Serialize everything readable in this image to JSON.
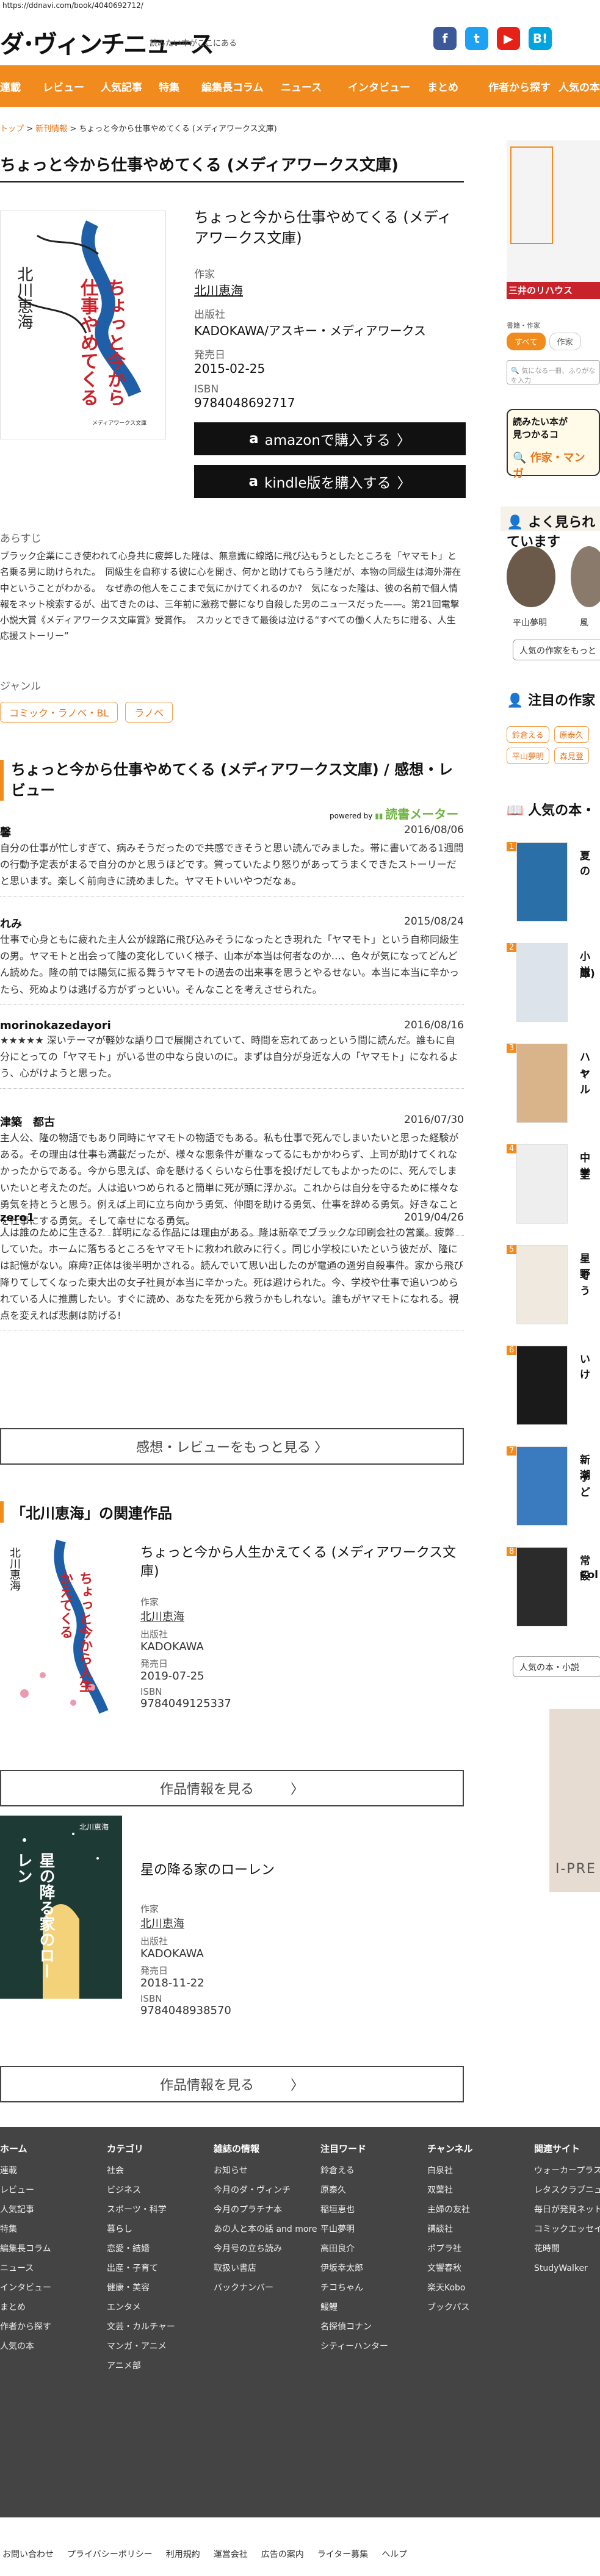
{
  "url": "https://ddnavi.com/book/4040692712/",
  "site": {
    "logo": "ダ･ヴィンチニュース",
    "tagline": "読みたい本がここにある"
  },
  "social": [
    {
      "name": "facebook",
      "glyph": "f",
      "color": "#3b5998"
    },
    {
      "name": "twitter",
      "glyph": "t",
      "color": "#1da1f2"
    },
    {
      "name": "youtube",
      "glyph": "▶",
      "color": "#e62117"
    },
    {
      "name": "hatena",
      "glyph": "B!",
      "color": "#00a4de"
    }
  ],
  "nav": [
    "連載",
    "レビュー",
    "人気記事",
    "特集",
    "編集長コラム",
    "ニュース",
    "インタビュー",
    "まとめ",
    "作者から探す",
    "人気の本"
  ],
  "breadcrumb": {
    "home": "トップ",
    "sep1": ">",
    "section": "新刊情報",
    "sep2": ">",
    "current": "ちょっと今から仕事やめてくる (メディアワークス文庫)"
  },
  "page_title": "ちょっと今から仕事やめてくる (メディアワークス文庫)",
  "book": {
    "title": "ちょっと今から仕事やめてくる (メディアワークス文庫)",
    "cover_author": "北川恵海",
    "cover_title": "ちょっと今から仕事やめてくる",
    "cover_footer": "メディアワークス文庫",
    "author_label": "作家",
    "author": "北川恵海",
    "publisher_label": "出版社",
    "publisher": "KADOKAWA/アスキー・メディアワークス",
    "date_label": "発売日",
    "date": "2015-02-25",
    "isbn_label": "ISBN",
    "isbn": "9784048692717",
    "amazon_btn": "amazonで購入する",
    "kindle_btn": "kindle版を購入する",
    "synopsis_label": "あらすじ",
    "synopsis": "ブラック企業にこき使われて心身共に疲弊した隆は、無意識に線路に飛び込もうとしたところを「ヤマモト」と名乗る男に助けられた。　同級生を自称する彼に心を開き、何かと助けてもらう隆だが、本物の同級生は海外滞在中ということがわかる。　なぜ赤の他人をここまで気にかけてくれるのか?　気になった隆は、彼の名前で個人情報をネット検索するが、出てきたのは、三年前に激務で鬱になり自殺した男のニュースだった——。第21回電撃小説大賞《メディアワークス文庫賞》受賞作。　スカッとできて最後は泣ける“すべての働く人たちに贈る、人生応援ストーリー”",
    "genre_label": "ジャンル",
    "genres": [
      "コミック・ラノベ・BL",
      "ラノベ"
    ]
  },
  "reviews_section": {
    "title": "ちょっと今から仕事やめてくる (メディアワークス文庫) / 感想・レビュー",
    "powered": "powered by",
    "meter": "読書メーター"
  },
  "reviews": [
    {
      "name": "馨",
      "date": "2016/08/06",
      "text": "自分の仕事が忙しすぎて、病みそうだったので共感できそうと思い読んでみました。帯に書いてある1週間の行動予定表がまるで自分のかと思うほどです。質っていたより怒りがあってうまくできたストーリーだと思います。楽しく前向きに読めました。ヤマモトいいやつだなぁ。"
    },
    {
      "name": "れみ",
      "date": "2015/08/24",
      "text": "仕事で心身ともに疲れた主人公が線路に飛び込みそうになったとき現れた「ヤマモト」という自称同級生の男。ヤマモトと出会って隆の変化していく様子、山本が本当は何者なのか…、色々が気になってどんどん読めた。隆の前では陽気に振る舞うヤマモトの過去の出来事を思うとやるせない。本当に本当に辛かったら、死ぬよりは逃げる方がずっといい。そんなことを考えさせられた。"
    },
    {
      "name": "morinokazedayori",
      "date": "2016/08/16",
      "text": "★★★★★ 深いテーマが軽妙な語り口で展開されていて、時間を忘れてあっという間に読んだ。誰もに自分にとっての「ヤマモト」がいる世の中なら良いのに。まずは自分が身近な人の「ヤマモト」になれるよう、心がけようと思った。"
    },
    {
      "name": "津築　都古",
      "date": "2016/07/30",
      "text": "主人公、隆の物語でもあり同時にヤマモトの物語でもある。私も仕事で死んでしまいたいと思った経験がある。その理由は仕事も満載だったが、様々な悪条件が重なってるにもかかわらず、上司が助けてくれなかったからである。今から思えば、命を懸けるくらいなら仕事を投げだしてもよかったのに、死んでしまいたいと考えたのだ。人は追いつめられると簡単に死が頭に浮かぶ。これからは自分を守るために様々な勇気を持とうと思う。例えば上司に立ち向かう勇気、仲間を助ける勇気、仕事を辞める勇気。好きなことを仕事にする勇気。そして幸せになる勇気。"
    },
    {
      "name": "zero1",
      "date": "2019/04/26",
      "text": "人は誰のために生きる?　詳明になる作品には理由がある。隆は新卒でブラックな印刷会社の営業。疲弊していた。ホームに落ちるところをヤマモトに救われ飲みに行く。同じ小学校にいたという彼だが、隆には記憶がない。麻痺?正体は後半明かされる。読んでいて思い出したのが電通の過労自殺事件。家から飛び降りてしてくなった東大出の女子社員が本当に辛かった。死は避けられた。今、学校や仕事で追いつめられている人に推薦したい。すぐに読め、あなたを死から救うかもしれない。誰もがヤマモトになれる。視点を変えれば悲劇は防げる!"
    }
  ],
  "more_reviews": "感想・レビューをもっと見る",
  "related": {
    "title": "「北川恵海」の関連作品",
    "items": [
      {
        "title": "ちょっと今から人生かえてくる (メディアワークス文庫)",
        "cover_title": "ちょっと今から人生かえてくる",
        "cover_author": "北川恵海",
        "author_label": "作家",
        "author": "北川恵海",
        "publisher_label": "出版社",
        "publisher": "KADOKAWA",
        "date_label": "発売日",
        "date": "2019-07-25",
        "isbn_label": "ISBN",
        "isbn": "9784049125337",
        "btn": "作品情報を見る"
      },
      {
        "title": "星の降る家のローレン",
        "cover_title": "星の降る家のローレン",
        "cover_author": "北川恵海",
        "author_label": "作家",
        "author": "北川恵海",
        "publisher_label": "出版社",
        "publisher": "KADOKAWA",
        "date_label": "発売日",
        "date": "2018-11-22",
        "isbn_label": "ISBN",
        "isbn": "9784048938570",
        "btn": "作品情報を見る"
      }
    ]
  },
  "sidebar": {
    "ad_title": "三井のリハウス",
    "tabs": [
      "すべて",
      "作家"
    ],
    "filter_label": "書籍・作家",
    "search_placeholder": "気になる一冊、ふりがなを入力",
    "promo_lines": [
      "読みたい本が",
      "見つかるコ"
    ],
    "promo_banner": "作家・マンガ",
    "popular_head": "よく見られています",
    "authors": [
      "平山夢明",
      "風"
    ],
    "popular_more": "人気の作家をもっと",
    "notice_head": "注目の作家",
    "notice_tags": [
      "鈴倉える",
      "原泰久",
      "平山夢明",
      "森見登"
    ],
    "ranking_head": "人気の本・",
    "books": [
      {
        "t": "夏の",
        "s": ""
      },
      {
        "t": "小説",
        "s": "庫)"
      },
      {
        "t": "ハッ",
        "s": "ヤル"
      },
      {
        "t": "中学",
        "s": "室"
      },
      {
        "t": "星野",
        "s": "そう"
      },
      {
        "t": "いけ",
        "s": ""
      },
      {
        "t": "新潮",
        "s": "子ど"
      },
      {
        "t": "常設",
        "s": "Col"
      }
    ],
    "ranking_more": "人気の本・小説",
    "ad2": "I-PRE"
  },
  "footer": {
    "cols": [
      {
        "head": "ホーム",
        "items": [
          "連載",
          "レビュー",
          "人気記事",
          "特集",
          "編集長コラム",
          "ニュース",
          "インタビュー",
          "まとめ",
          "作者から探す",
          "人気の本"
        ]
      },
      {
        "head": "カテゴリ",
        "items": [
          "社会",
          "ビジネス",
          "スポーツ・科学",
          "暮らし",
          "恋愛・結婚",
          "出産・子育て",
          "健康・美容",
          "エンタメ",
          "文芸・カルチャー",
          "マンガ・アニメ",
          "アニメ部"
        ]
      },
      {
        "head": "雑誌の情報",
        "items": [
          "お知らせ",
          "今月のダ・ヴィンチ",
          "今月のプラチナ本",
          "あの人と本の話 and more",
          "今月号の立ち読み",
          "取扱い書店",
          "バックナンバー"
        ]
      },
      {
        "head": "注目ワード",
        "items": [
          "鈴倉える",
          "原泰久",
          "稲垣恵也",
          "平山夢明",
          "高田良介",
          "伊坂幸太郎",
          "チコちゃん",
          "鰻鯉",
          "名探偵コナン",
          "シティーハンター"
        ]
      },
      {
        "head": "チャンネル",
        "items": [
          "白泉社",
          "双葉社",
          "主婦の友社",
          "講談社",
          "ポプラ社",
          "文響春秋",
          "楽天Kobo",
          "ブックパス"
        ]
      },
      {
        "head": "関連サイト",
        "items": [
          "ウォーカープラス",
          "レタスクラブニュース",
          "毎日が発見ネット",
          "コミックエッセイ劇場",
          "花時間",
          "StudyWalker"
        ]
      }
    ],
    "links": [
      "お問い合わせ",
      "プライバシーポリシー",
      "利用規約",
      "運営会社",
      "広告の案内",
      "ライター募集",
      "ヘルプ"
    ]
  }
}
